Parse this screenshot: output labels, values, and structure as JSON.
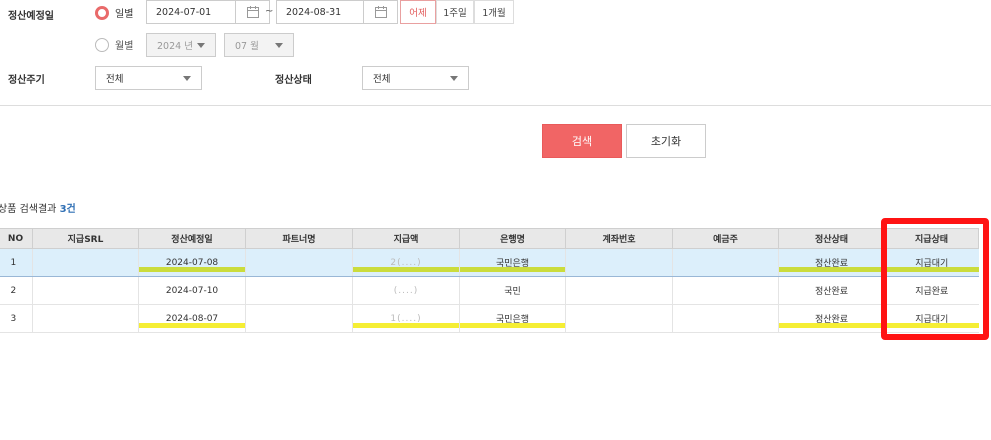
{
  "filters": {
    "settle_date_label": "정산예정일",
    "radio_daily": "일별",
    "radio_monthly": "월별",
    "start_date": "2024-07-01",
    "range_sep": "~",
    "end_date": "2024-08-31",
    "quick_ranges": [
      "어제",
      "1주일",
      "1개월"
    ],
    "month_year": "2024 년",
    "month_month": "07 월",
    "cycle_label": "정산주기",
    "cycle_value": "전체",
    "status_label": "정산상태",
    "status_value": "전체"
  },
  "actions": {
    "search": "검색",
    "reset": "초기화"
  },
  "results": {
    "prefix": "상품 검색결과",
    "count": "3건"
  },
  "table": {
    "headers": [
      "NO",
      "지급SRL",
      "정산예정일",
      "파트너명",
      "지급액",
      "은행명",
      "계좌번호",
      "예금주",
      "정산상태",
      "지급상태"
    ],
    "rows": [
      {
        "no": "1",
        "srl": "",
        "date": "2024-07-08",
        "partner": "",
        "amount": "2(....)",
        "bank": "국민은행",
        "account": "",
        "holder": "",
        "settle": "정산완료",
        "pay": "지급대기"
      },
      {
        "no": "2",
        "srl": "",
        "date": "2024-07-10",
        "partner": "",
        "amount": "(....)",
        "bank": "국민",
        "account": "",
        "holder": "",
        "settle": "정산완료",
        "pay": "지급완료"
      },
      {
        "no": "3",
        "srl": "",
        "date": "2024-08-07",
        "partner": "",
        "amount": "1(....)",
        "bank": "국민은행",
        "account": "",
        "holder": "",
        "settle": "정산완료",
        "pay": "지급대기"
      }
    ]
  },
  "colors": {
    "accent": "#f16565",
    "highlight": "#f5ee34",
    "annotation": "#ff1313",
    "count": "#2f6fb4"
  }
}
